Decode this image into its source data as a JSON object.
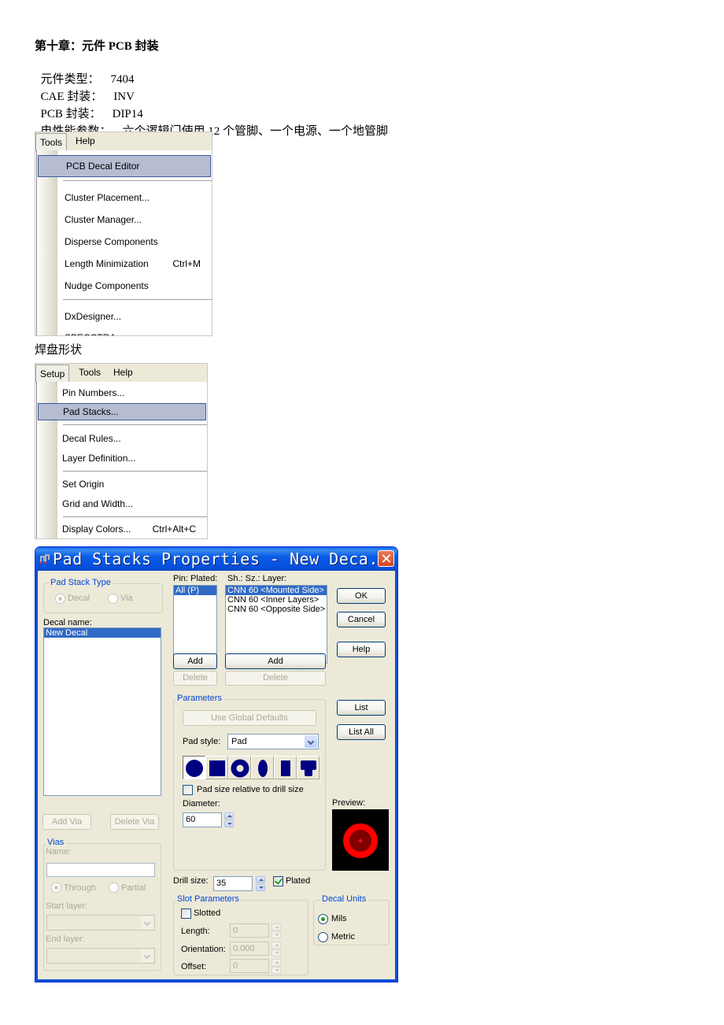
{
  "document": {
    "title": "第十章：元件 PCB 封装",
    "fields": [
      {
        "label": "元件类型：",
        "value": "7404"
      },
      {
        "label": "CAE 封装：",
        "value": "INV"
      },
      {
        "label": "PCB 封装：",
        "value": "DIP14"
      },
      {
        "label": "电性能参数：",
        "value": "六个逻辑门使用 12 个管脚、一个电源、一个地管脚"
      }
    ],
    "section_pad_shape": "焊盘形状"
  },
  "tools_menu": {
    "menubar": [
      "Tools",
      "Help"
    ],
    "items": [
      {
        "label": "PCB Decal Editor",
        "shortcut": "",
        "highlighted": true
      },
      {
        "label": "Cluster Placement...",
        "shortcut": ""
      },
      {
        "label": "Cluster Manager...",
        "shortcut": ""
      },
      {
        "label": "Disperse Components",
        "shortcut": ""
      },
      {
        "label": "Length Minimization",
        "shortcut": "Ctrl+M"
      },
      {
        "label": "Nudge Components",
        "shortcut": ""
      },
      {
        "label": "DxDesigner...",
        "shortcut": ""
      },
      {
        "label": "SPECCTRA",
        "shortcut": ""
      }
    ]
  },
  "setup_menu": {
    "menubar": [
      "Setup",
      "Tools",
      "Help"
    ],
    "items": [
      {
        "label": "Pin Numbers...",
        "shortcut": ""
      },
      {
        "label": "Pad Stacks...",
        "shortcut": "",
        "highlighted": true
      },
      {
        "label": "Decal Rules...",
        "shortcut": ""
      },
      {
        "label": "Layer Definition...",
        "shortcut": ""
      },
      {
        "label": "Set Origin",
        "shortcut": ""
      },
      {
        "label": "Grid and Width...",
        "shortcut": ""
      },
      {
        "label": "Display Colors...",
        "shortcut": "Ctrl+Alt+C"
      }
    ]
  },
  "dialog": {
    "title": "Pad Stacks Properties - New Deca...",
    "pad_stack_type": {
      "label": "Pad Stack Type",
      "options": [
        "Decal",
        "Via"
      ],
      "selected": "Decal"
    },
    "decal_name_label": "Decal name:",
    "decal_list": [
      "New Decal"
    ],
    "add_via": "Add Via",
    "delete_via": "Delete Via",
    "vias": {
      "label": "Vias",
      "name_label": "Name:",
      "name_value": "",
      "options": [
        "Through",
        "Partial"
      ],
      "selected": "Through",
      "start_layer_label": "Start layer:",
      "end_layer_label": "End layer:"
    },
    "pin_header": "Pin: Plated:",
    "layer_header": "Sh.: Sz.: Layer:",
    "pin_list": [
      "All (P)"
    ],
    "layer_list": [
      "CNN 60 <Mounted Side>",
      "CNN 60 <Inner Layers>",
      "CNN 60 <Opposite Side>"
    ],
    "add_pin": "Add",
    "add_layer": "Add",
    "delete_pin": "Delete",
    "delete_layer": "Delete",
    "parameters": {
      "label": "Parameters",
      "use_global_defaults": "Use Global Defaults",
      "pad_style_label": "Pad style:",
      "pad_style_value": "Pad",
      "shapes": [
        "round-pad",
        "square-pad",
        "annular-pad",
        "oval-pad",
        "rectangle-pad",
        "thermal-pad"
      ],
      "selected_shape": "round-pad",
      "pad_relative_label": "Pad size relative to drill size",
      "pad_relative_checked": false,
      "diameter_label": "Diameter:",
      "diameter_value": "60"
    },
    "preview_label": "Preview:",
    "drill_size_label": "Drill size:",
    "drill_size_value": "35",
    "plated_label": "Plated",
    "plated_checked": true,
    "slot": {
      "label": "Slot Parameters",
      "slotted_label": "Slotted",
      "slotted_checked": false,
      "length_label": "Length:",
      "length_value": "0",
      "orientation_label": "Orientation:",
      "orientation_value": "0.000",
      "offset_label": "Offset:",
      "offset_value": "0"
    },
    "units": {
      "label": "Decal Units",
      "options": [
        "Mils",
        "Metric"
      ],
      "selected": "Mils"
    },
    "buttons": {
      "ok": "OK",
      "cancel": "Cancel",
      "help": "Help",
      "list": "List",
      "list_all": "List All"
    },
    "colors": {
      "titlebar": "#0a5ce6",
      "pad_shape": "#000080",
      "preview_pad": "#ff0000",
      "preview_drill": "#800000",
      "preview_bg": "#000000"
    }
  }
}
